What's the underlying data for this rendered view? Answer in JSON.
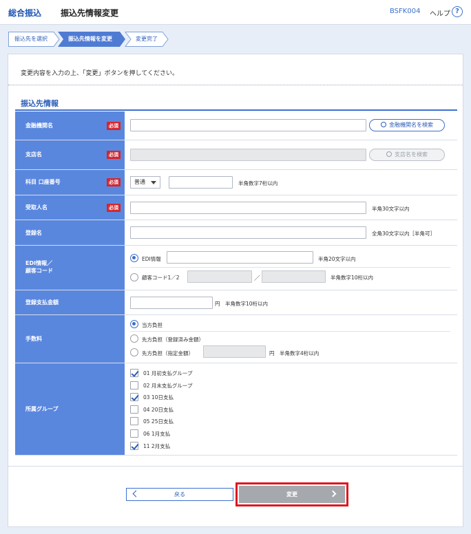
{
  "header": {
    "app": "総合振込",
    "title": "振込先情報変更",
    "screen_code": "BSFK004",
    "help": "ヘルプ",
    "help_icon": "?"
  },
  "steps": [
    "振込先を選択",
    "振込先情報を変更",
    "変更完了"
  ],
  "intro": "変更内容を入力の上、「変更」ボタンを押してください。",
  "section_title": "振込先情報",
  "required": "必須",
  "fields": {
    "bank": {
      "label": "金融機関名",
      "button": "金融機関名を検索"
    },
    "branch": {
      "label": "支店名",
      "button": "支店名を検索"
    },
    "account": {
      "label": "科目 口座番号",
      "type_value": "普通",
      "hint": "半角数字7桁以内"
    },
    "recipient": {
      "label": "受取人名",
      "hint": "半角30文字以内"
    },
    "registered": {
      "label": "登録名",
      "hint": "全角30文字以内［半角可］"
    },
    "edi": {
      "label_line1": "EDI情報／",
      "label_line2": "顧客コード",
      "option1": "EDI情報",
      "hint1": "半角20文字以内",
      "option2": "顧客コード1／2",
      "slash": "／",
      "hint2": "半角数字10桁以内"
    },
    "amount": {
      "label": "登録支払金額",
      "unit": "円",
      "hint": "半角数字10桁以内"
    },
    "fee": {
      "label": "手数料",
      "option1": "当方負担",
      "option2": "先方負担（登録済み金額）",
      "option3": "先方負担（指定金額）",
      "unit": "円",
      "hint": "半角数字4桁以内"
    },
    "group": {
      "label": "所属グループ",
      "items": [
        {
          "text": "01 月初支払グループ",
          "checked": true
        },
        {
          "text": "02 月末支払グループ",
          "checked": false
        },
        {
          "text": "03 10日支払",
          "checked": true
        },
        {
          "text": "04 20日支払",
          "checked": false
        },
        {
          "text": "05 25日支払",
          "checked": false
        },
        {
          "text": "06 1月支払",
          "checked": false
        },
        {
          "text": "11 2月支払",
          "checked": true
        }
      ]
    }
  },
  "buttons": {
    "back": "戻る",
    "submit": "変更"
  },
  "colors": {
    "label_bg": "#5a87de",
    "accent": "#3d6fcf",
    "required": "#d4262e",
    "highlight": "#e1141e"
  }
}
